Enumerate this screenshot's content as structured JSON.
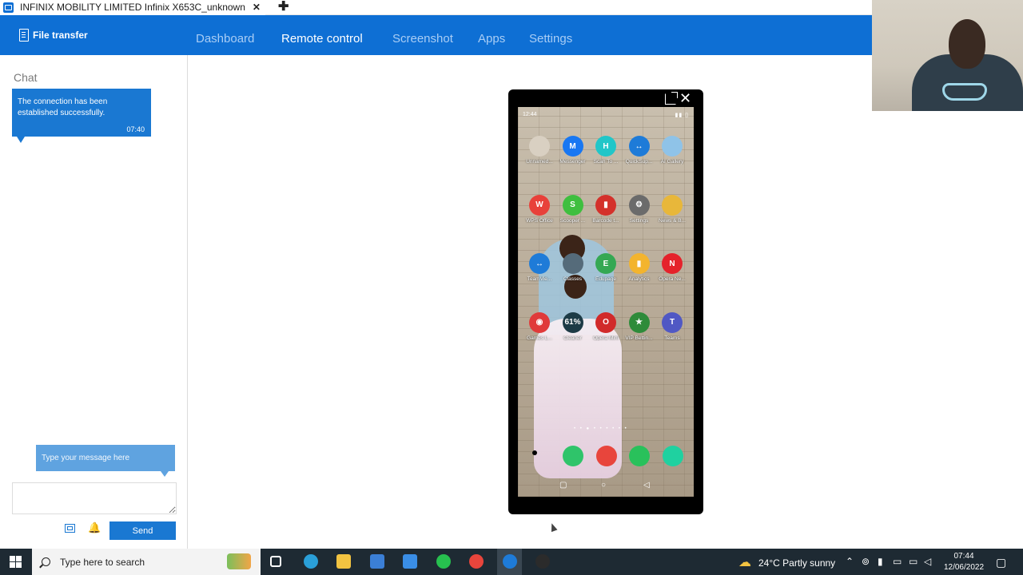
{
  "tab": {
    "title": "INFINIX MOBILITY LIMITED Infinix X653C_unknown",
    "close": "✕",
    "add": "✚"
  },
  "nav": {
    "file_transfer": "File transfer",
    "items": [
      "Dashboard",
      "Remote control",
      "Screenshot",
      "Apps",
      "Settings"
    ],
    "active": "Remote control"
  },
  "chat": {
    "title": "Chat",
    "message": {
      "text": "The connection has been established successfully.",
      "time": "07:40"
    },
    "hint": "Type your message here",
    "input_value": "",
    "send_label": "Send",
    "bell_glyph": "🔔"
  },
  "phone": {
    "status_time": "12:44",
    "close_glyph": "✕",
    "apps": [
      {
        "label": "Unnamed...",
        "color": "#d9d0c2",
        "glyph": ""
      },
      {
        "label": "Messenger",
        "color": "#1877f2",
        "glyph": "M"
      },
      {
        "label": "Scan To ...",
        "color": "#21c6c8",
        "glyph": "H"
      },
      {
        "label": "QuickSup...",
        "color": "#1e7bd8",
        "glyph": "↔"
      },
      {
        "label": "AI Gallery",
        "color": "#8fc3e8",
        "glyph": ""
      },
      {
        "label": "WPS Office",
        "color": "#e8413a",
        "glyph": "W"
      },
      {
        "label": "Scooper ...",
        "color": "#3fbf3f",
        "glyph": "S"
      },
      {
        "label": "Barcode t...",
        "color": "#d4312b",
        "glyph": "▮"
      },
      {
        "label": "Settings",
        "color": "#6b6b6b",
        "glyph": "⚙"
      },
      {
        "label": "News & B...",
        "color": "#e8b73a",
        "glyph": ""
      },
      {
        "label": "TeamVie...",
        "color": "#1e7bd8",
        "glyph": "↔"
      },
      {
        "label": "Classes",
        "color": "#556b7a",
        "glyph": ""
      },
      {
        "label": "Edupage",
        "color": "#35a853",
        "glyph": "E"
      },
      {
        "label": "Analytics",
        "color": "#f3b42e",
        "glyph": "▮"
      },
      {
        "label": "Opera Ne...",
        "color": "#e5222b",
        "glyph": "N"
      },
      {
        "label": "Games L...",
        "color": "#e03a3a",
        "glyph": "◉"
      },
      {
        "label": "Cleaner",
        "color": "#1d3b46",
        "glyph": "61%"
      },
      {
        "label": "Opera Mini",
        "color": "#d12a2a",
        "glyph": "O"
      },
      {
        "label": "VIP Bettin...",
        "color": "#2e8b3a",
        "glyph": "★"
      },
      {
        "label": "Teams",
        "color": "#5058c4",
        "glyph": "T"
      }
    ],
    "page_dots": "• • ● • • • • • •",
    "dock": [
      {
        "name": "phone-app",
        "color": "#2fc46a"
      },
      {
        "name": "chrome-app",
        "color": "#e8453c"
      },
      {
        "name": "whatsapp-app",
        "color": "#29c15b"
      },
      {
        "name": "messages-app",
        "color": "#1fd1a0"
      }
    ],
    "nav_buttons": [
      "▢",
      "○",
      "◁"
    ]
  },
  "taskbar": {
    "search_placeholder": "Type here to search",
    "weather": "24°C  Partly sunny",
    "time": "07:44",
    "date": "12/06/2022",
    "icons": [
      {
        "name": "task-view-icon",
        "color": "#ffffff"
      },
      {
        "name": "edge-icon",
        "color": "#2a9fd8"
      },
      {
        "name": "file-explorer-icon",
        "color": "#f2c341"
      },
      {
        "name": "store-icon",
        "color": "#3b7fd6"
      },
      {
        "name": "mail-icon",
        "color": "#3a8ee6"
      },
      {
        "name": "whatsapp-icon",
        "color": "#27c04f"
      },
      {
        "name": "chrome-icon",
        "color": "#e8453c"
      },
      {
        "name": "teamviewer-icon",
        "color": "#1e7bd8"
      },
      {
        "name": "obs-icon",
        "color": "#2b2b2b"
      }
    ]
  },
  "colors": {
    "brand": "#0e6fd4",
    "nav_inactive": "#a9cdf5",
    "taskbar": "#1e2a33"
  }
}
